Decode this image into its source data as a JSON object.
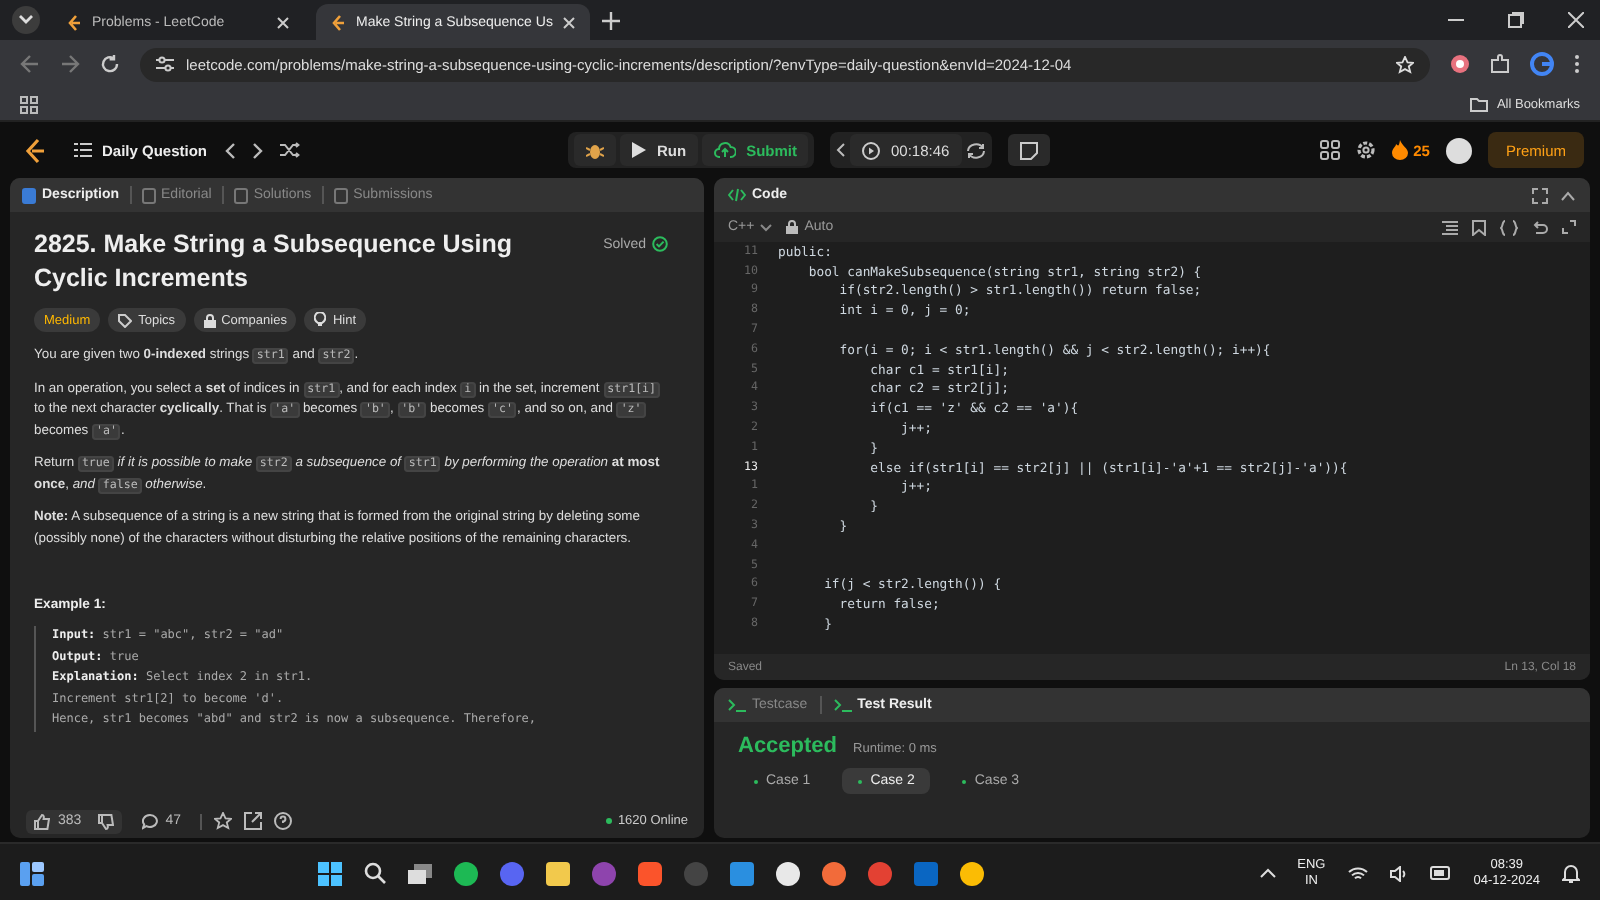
{
  "browser": {
    "tabs": [
      {
        "title": "Problems - LeetCode",
        "selected": false
      },
      {
        "title": "Make String a Subsequence Us",
        "selected": true
      }
    ],
    "url": "leetcode.com/problems/make-string-a-subsequence-using-cyclic-increments/description/?envType=daily-question&envId=2024-12-04",
    "bookmarks_label": "All Bookmarks"
  },
  "header": {
    "title": "Daily Question",
    "run": "Run",
    "submit": "Submit",
    "timer": "00:18:46",
    "streak": "25",
    "premium": "Premium"
  },
  "left_tabs": [
    {
      "label": "Description",
      "selected": true
    },
    {
      "label": "Editorial",
      "selected": false
    },
    {
      "label": "Solutions",
      "selected": false
    },
    {
      "label": "Submissions",
      "selected": false
    }
  ],
  "problem": {
    "title": "2825. Make String a Subsequence Using Cyclic Increments",
    "status": "Solved",
    "tags": [
      {
        "label": "Medium",
        "kind": "difficulty"
      },
      {
        "label": "Topics",
        "kind": "topics"
      },
      {
        "label": "Companies",
        "kind": "companies"
      },
      {
        "label": "Hint",
        "kind": "hint"
      }
    ],
    "paragraphs": [
      [
        {
          "kind": "text",
          "text": "You are given two **0-indexed** strings "
        },
        {
          "kind": "code",
          "text": "str1"
        },
        {
          "kind": "text",
          "text": " and "
        },
        {
          "kind": "code",
          "text": "str2"
        },
        {
          "kind": "text",
          "text": "."
        }
      ],
      [
        {
          "kind": "text",
          "text": "In an operation, you select a **set** of indices in "
        },
        {
          "kind": "code",
          "text": "str1"
        },
        {
          "kind": "text",
          "text": ", and for each index "
        },
        {
          "kind": "code",
          "text": "i"
        },
        {
          "kind": "text",
          "text": " in the set, increment "
        },
        {
          "kind": "code",
          "text": "str1[i]"
        },
        {
          "kind": "text",
          "text": " to the next character **cyclically**. That is "
        },
        {
          "kind": "code",
          "text": "'a'"
        },
        {
          "kind": "text",
          "text": " becomes "
        },
        {
          "kind": "code",
          "text": "'b'"
        },
        {
          "kind": "text",
          "text": ", "
        },
        {
          "kind": "code",
          "text": "'b'"
        },
        {
          "kind": "text",
          "text": " becomes "
        },
        {
          "kind": "code",
          "text": "'c'"
        },
        {
          "kind": "text",
          "text": ", and so on, and "
        },
        {
          "kind": "code",
          "text": "'z'"
        },
        {
          "kind": "text",
          "text": " becomes "
        },
        {
          "kind": "code",
          "text": "'a'"
        },
        {
          "kind": "text",
          "text": "."
        }
      ],
      [
        {
          "kind": "text",
          "text": "Return "
        },
        {
          "kind": "code",
          "text": "true"
        },
        {
          "kind": "text",
          "text": " *if it is possible to make* "
        },
        {
          "kind": "code",
          "text": "str2"
        },
        {
          "kind": "text",
          "text": " *a subsequence of* "
        },
        {
          "kind": "code",
          "text": "str1"
        },
        {
          "kind": "text",
          "text": " *by performing the operation* **at most once**, *and* "
        },
        {
          "kind": "code",
          "text": "false"
        },
        {
          "kind": "text",
          "text": " *otherwise*."
        }
      ],
      [
        {
          "kind": "text",
          "text": "**Note:** A subsequence of a string is a new string that is formed from the original string by deleting some (possibly none) of the characters without disturbing the relative positions of the remaining characters."
        }
      ]
    ],
    "example_heading": "Example 1:",
    "example_lines": [
      "**Input:** str1 = \"abc\", str2 = \"ad\"",
      "**Output:** true",
      "**Explanation:** Select index 2 in str1.",
      "Increment str1[2] to become 'd'.",
      "Hence, str1 becomes \"abd\" and str2 is now a subsequence. Therefore,"
    ],
    "likes": "383",
    "comments": "47",
    "online": "1620 Online"
  },
  "code_panel": {
    "title": "Code",
    "language": "C++",
    "mode": "Auto",
    "status": "Saved",
    "cursor": "Ln 13, Col 18",
    "lines": [
      {
        "number": "11",
        "text": "public:",
        "current": false
      },
      {
        "number": "10",
        "text": "    bool canMakeSubsequence(string str1, string str2) {",
        "current": false
      },
      {
        "number": "9",
        "text": "        if(str2.length() > str1.length()) return false;",
        "current": false
      },
      {
        "number": "8",
        "text": "        int i = 0, j = 0;",
        "current": false
      },
      {
        "number": "7",
        "current": false
      },
      {
        "number": "6",
        "text": "        for(i = 0; i < str1.length() && j < str2.length(); i++){",
        "current": false
      },
      {
        "number": "5",
        "text": "            char c1 = str1[i];",
        "current": false
      },
      {
        "number": "4",
        "text": "            char c2 = str2[j];",
        "current": false
      },
      {
        "number": "3",
        "text": "            if(c1 == 'z' && c2 == 'a'){",
        "current": false
      },
      {
        "number": "2",
        "text": "                j++;",
        "current": false
      },
      {
        "number": "1",
        "text": "            }",
        "current": false
      },
      {
        "number": "13",
        "text": "            else if(str1[i] == str2[j] || (str1[i]-'a'+1 == str2[j]-'a')){",
        "current": true
      },
      {
        "number": "1",
        "text": "                j++;",
        "current": false
      },
      {
        "number": "2",
        "text": "            }",
        "current": false
      },
      {
        "number": "3",
        "text": "        }",
        "current": false
      },
      {
        "number": "4",
        "current": false
      },
      {
        "number": "5",
        "current": false
      },
      {
        "number": "6",
        "text": "      if(j < str2.length()) {",
        "current": false
      },
      {
        "number": "7",
        "text": "        return false;",
        "current": false
      },
      {
        "number": "8",
        "text": "      }",
        "current": false
      }
    ]
  },
  "test_panel": {
    "tabs": [
      {
        "label": "Testcase",
        "selected": false
      },
      {
        "label": "Test Result",
        "selected": true
      }
    ],
    "verdict": "Accepted",
    "runtime": "Runtime: 0 ms",
    "cases": [
      {
        "label": "Case 1",
        "selected": false
      },
      {
        "label": "Case 2",
        "selected": true
      },
      {
        "label": "Case 3",
        "selected": false
      }
    ]
  },
  "taskbar": {
    "language": "ENG",
    "region": "IN",
    "time": "08:39",
    "date": "04-12-2024"
  }
}
